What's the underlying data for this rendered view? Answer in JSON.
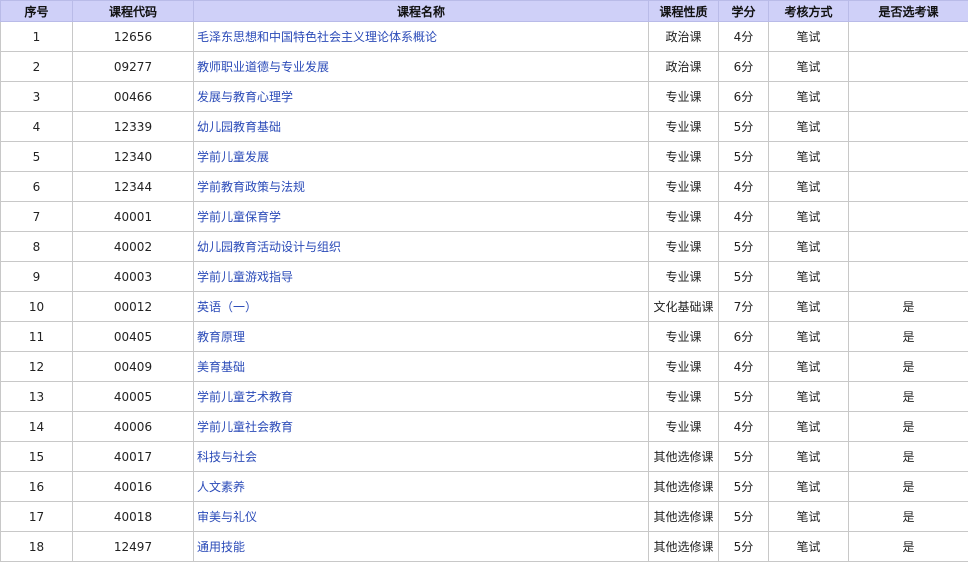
{
  "colors": {
    "header_bg": "#cfd0f8",
    "link": "#2b4bb8",
    "border": "#c8c8c8"
  },
  "headers": [
    "序号",
    "课程代码",
    "课程名称",
    "课程性质",
    "学分",
    "考核方式",
    "是否选考课"
  ],
  "rows": [
    {
      "no": "1",
      "code": "12656",
      "name": "毛泽东思想和中国特色社会主义理论体系概论",
      "type": "政治课",
      "credit": "4分",
      "exam": "笔试",
      "elective": ""
    },
    {
      "no": "2",
      "code": "09277",
      "name": "教师职业道德与专业发展",
      "type": "政治课",
      "credit": "6分",
      "exam": "笔试",
      "elective": ""
    },
    {
      "no": "3",
      "code": "00466",
      "name": "发展与教育心理学",
      "type": "专业课",
      "credit": "6分",
      "exam": "笔试",
      "elective": ""
    },
    {
      "no": "4",
      "code": "12339",
      "name": "幼儿园教育基础",
      "type": "专业课",
      "credit": "5分",
      "exam": "笔试",
      "elective": ""
    },
    {
      "no": "5",
      "code": "12340",
      "name": "学前儿童发展",
      "type": "专业课",
      "credit": "5分",
      "exam": "笔试",
      "elective": ""
    },
    {
      "no": "6",
      "code": "12344",
      "name": "学前教育政策与法规",
      "type": "专业课",
      "credit": "4分",
      "exam": "笔试",
      "elective": ""
    },
    {
      "no": "7",
      "code": "40001",
      "name": "学前儿童保育学",
      "type": "专业课",
      "credit": "4分",
      "exam": "笔试",
      "elective": ""
    },
    {
      "no": "8",
      "code": "40002",
      "name": "幼儿园教育活动设计与组织",
      "type": "专业课",
      "credit": "5分",
      "exam": "笔试",
      "elective": ""
    },
    {
      "no": "9",
      "code": "40003",
      "name": "学前儿童游戏指导",
      "type": "专业课",
      "credit": "5分",
      "exam": "笔试",
      "elective": ""
    },
    {
      "no": "10",
      "code": "00012",
      "name": "英语（一）",
      "type": "文化基础课",
      "credit": "7分",
      "exam": "笔试",
      "elective": "是"
    },
    {
      "no": "11",
      "code": "00405",
      "name": "教育原理",
      "type": "专业课",
      "credit": "6分",
      "exam": "笔试",
      "elective": "是"
    },
    {
      "no": "12",
      "code": "00409",
      "name": "美育基础",
      "type": "专业课",
      "credit": "4分",
      "exam": "笔试",
      "elective": "是"
    },
    {
      "no": "13",
      "code": "40005",
      "name": "学前儿童艺术教育",
      "type": "专业课",
      "credit": "5分",
      "exam": "笔试",
      "elective": "是"
    },
    {
      "no": "14",
      "code": "40006",
      "name": "学前儿童社会教育",
      "type": "专业课",
      "credit": "4分",
      "exam": "笔试",
      "elective": "是"
    },
    {
      "no": "15",
      "code": "40017",
      "name": "科技与社会",
      "type": "其他选修课",
      "credit": "5分",
      "exam": "笔试",
      "elective": "是"
    },
    {
      "no": "16",
      "code": "40016",
      "name": "人文素养",
      "type": "其他选修课",
      "credit": "5分",
      "exam": "笔试",
      "elective": "是"
    },
    {
      "no": "17",
      "code": "40018",
      "name": "审美与礼仪",
      "type": "其他选修课",
      "credit": "5分",
      "exam": "笔试",
      "elective": "是"
    },
    {
      "no": "18",
      "code": "12497",
      "name": "通用技能",
      "type": "其他选修课",
      "credit": "5分",
      "exam": "笔试",
      "elective": "是"
    }
  ]
}
